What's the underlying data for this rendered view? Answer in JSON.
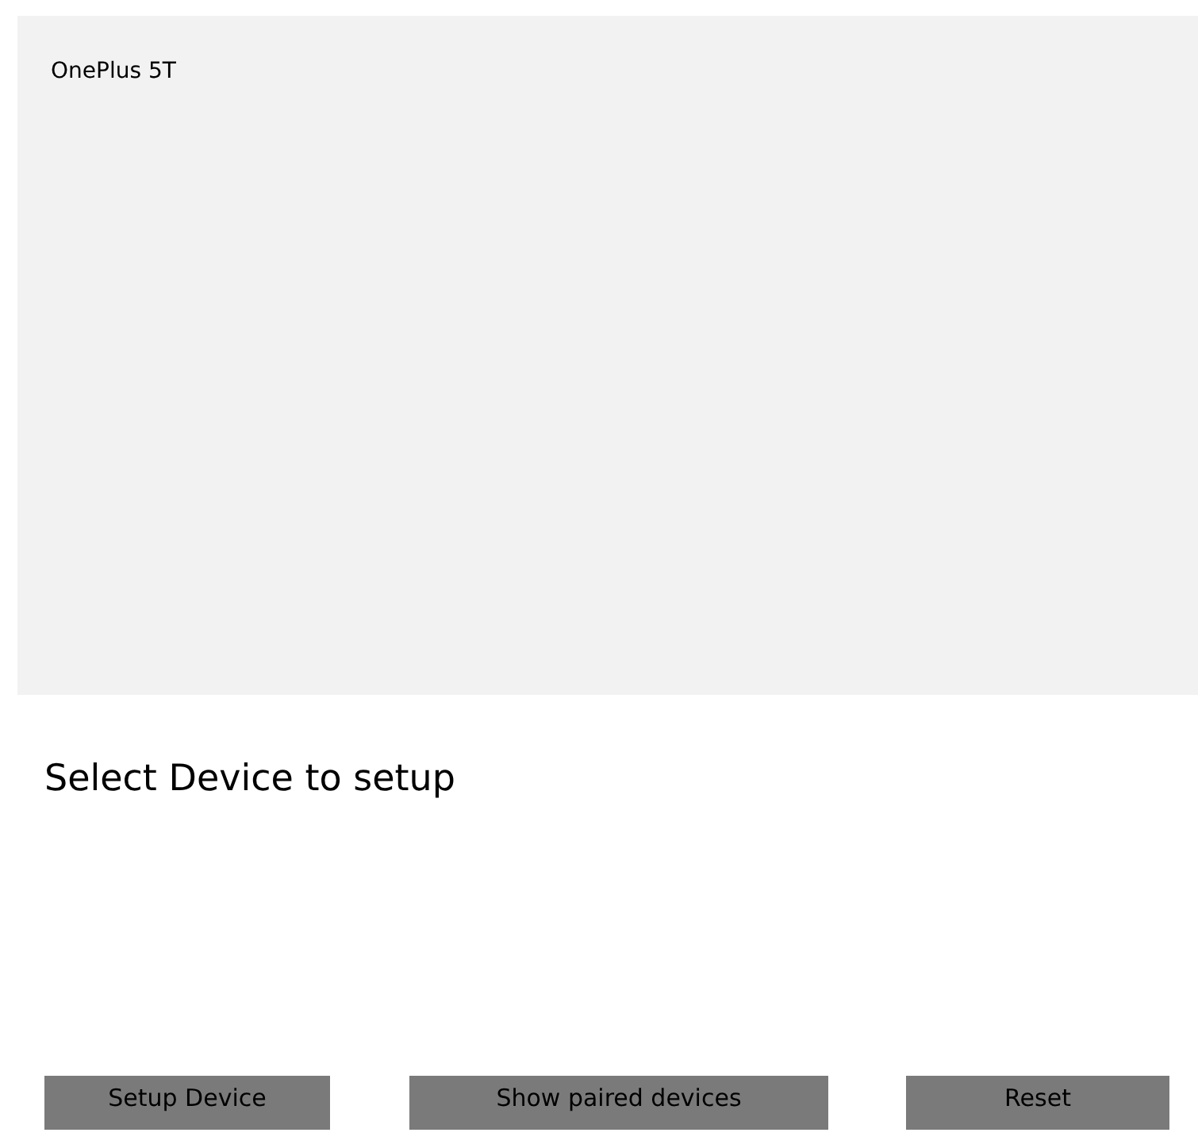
{
  "device_list": {
    "items": [
      {
        "label": "OnePlus 5T",
        "selected": false
      }
    ]
  },
  "prompt": "Select Device to setup",
  "buttons": [
    {
      "label": "Setup Device"
    },
    {
      "label": "Show paired devices"
    },
    {
      "label": "Reset"
    }
  ]
}
